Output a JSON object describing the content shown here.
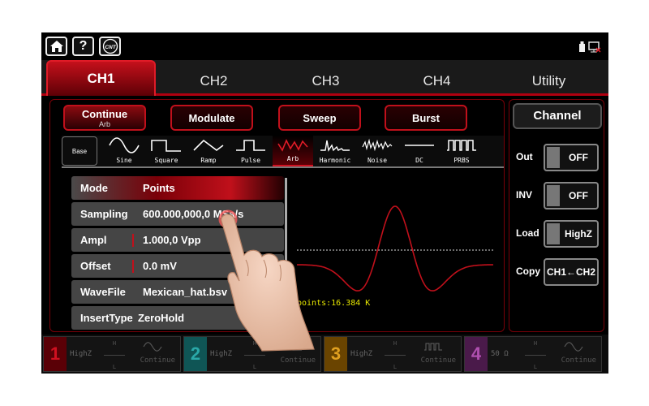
{
  "colors": {
    "accent": "#c0101b",
    "background": "#000000",
    "trace": "#c0101b",
    "points_text": "#e6e600"
  },
  "topbar": {
    "home_icon": "home-icon",
    "help_label": "?",
    "cnt_label": "CNT",
    "status_icons": [
      "usb-icon",
      "network-icon"
    ]
  },
  "tabs": [
    {
      "label": "CH1",
      "active": true
    },
    {
      "label": "CH2"
    },
    {
      "label": "CH3"
    },
    {
      "label": "CH4"
    },
    {
      "label": "Utility"
    }
  ],
  "modes": {
    "continue": {
      "label": "Continue",
      "sub": "Arb"
    },
    "modulate": {
      "label": "Modulate"
    },
    "sweep": {
      "label": "Sweep"
    },
    "burst": {
      "label": "Burst"
    }
  },
  "waveforms": {
    "base": "Base",
    "items": [
      "Sine",
      "Square",
      "Ramp",
      "Pulse",
      "Arb",
      "Harmonic",
      "Noise",
      "DC",
      "PRBS"
    ],
    "selected": "Arb"
  },
  "params": [
    {
      "name": "Mode",
      "value": "Points"
    },
    {
      "name": "Sampling",
      "value": "600.000,000,0 MSa/s"
    },
    {
      "name": "Ampl",
      "value": "1.000,0 Vpp"
    },
    {
      "name": "Offset",
      "value": "0.0 mV"
    },
    {
      "name": "WaveFile",
      "value": "Mexican_hat.bsv"
    },
    {
      "name": "InsertType",
      "value": "ZeroHold"
    }
  ],
  "preview": {
    "points_text": "points:16.384 K",
    "waveform": "mexican-hat"
  },
  "channel_panel": {
    "title": "Channel",
    "out": {
      "label": "Out",
      "value": "OFF"
    },
    "inv": {
      "label": "INV",
      "value": "OFF"
    },
    "load": {
      "label": "Load",
      "value": "HighZ"
    },
    "copy": {
      "label": "Copy",
      "value": "CH1←CH2"
    }
  },
  "channels": [
    {
      "num": "1",
      "imp": "HighZ",
      "mode": "Continue",
      "h": "H",
      "l": "L",
      "color": "#c0101b",
      "wave": "sine"
    },
    {
      "num": "2",
      "imp": "HighZ",
      "mode": "Continue",
      "h": "H",
      "l": "L",
      "color": "#178a8a",
      "wave": "square"
    },
    {
      "num": "3",
      "imp": "HighZ",
      "mode": "Continue",
      "h": "H",
      "l": "L",
      "color": "#d08a10",
      "wave": "prbs"
    },
    {
      "num": "4",
      "imp": "50 Ω",
      "mode": "Continue",
      "h": "H",
      "l": "L",
      "color": "#a03aa0",
      "wave": "sine"
    }
  ]
}
